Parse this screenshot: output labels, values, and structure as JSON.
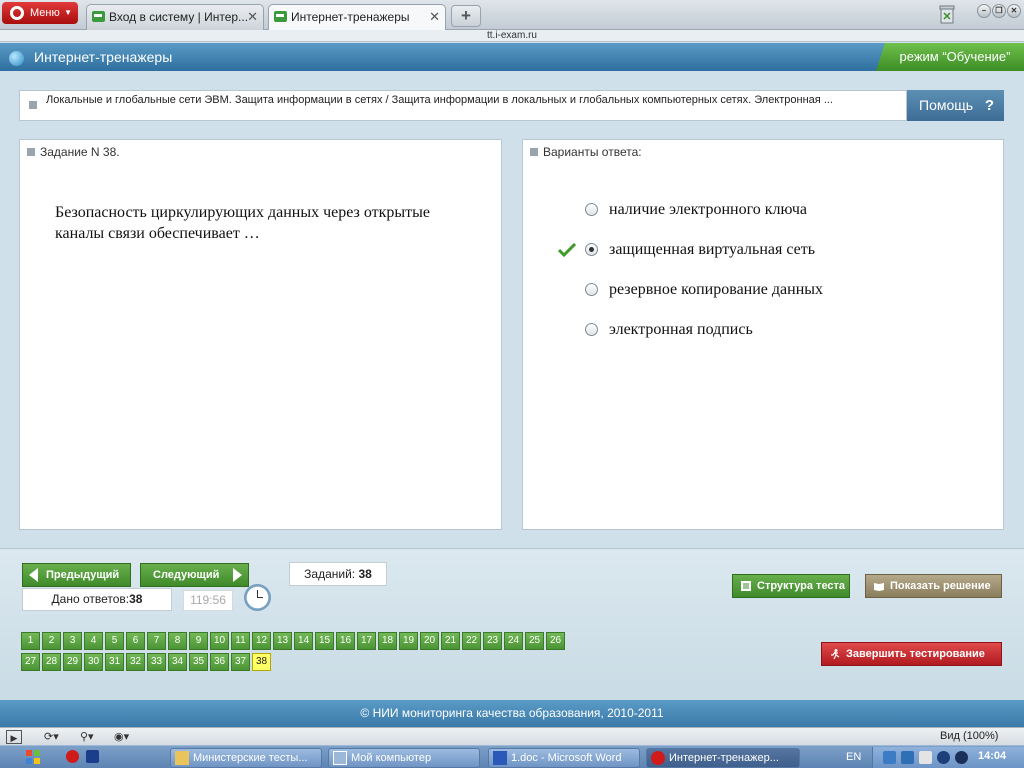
{
  "browser": {
    "menu_label": "Меню",
    "tabs": [
      {
        "label": "Вход в систему | Интер..."
      },
      {
        "label": "Интернет-тренажеры"
      }
    ],
    "address": "tt.i-exam.ru",
    "zoom_label": "Вид (100%)"
  },
  "app": {
    "title": "Интернет-тренажеры",
    "mode": "режим “Обучение”",
    "breadcrumb": "Локальные и глобальные сети ЭВМ. Защита информации в сетях / Защита информации в локальных и глобальных компьютерных сетях. Электронная ...",
    "help_label": "Помощь",
    "help_mark": "?"
  },
  "question": {
    "header": "Задание N 38.",
    "text": "Безопасность циркулирующих данных через открытые каналы связи обеспечивает …"
  },
  "answers": {
    "header": "Варианты ответа:",
    "options": [
      {
        "label": "наличие электронного ключа",
        "selected": false
      },
      {
        "label": "защищенная виртуальная сеть",
        "selected": true
      },
      {
        "label": "резервное копирование данных",
        "selected": false
      },
      {
        "label": "электронная подпись",
        "selected": false
      }
    ]
  },
  "controls": {
    "prev_label": "Предыдущий",
    "next_label": "Следующий",
    "tasks_label": "Заданий:",
    "tasks_count": "38",
    "answered_label": "Дано ответов:",
    "answered_count": "38",
    "timer": "119:56",
    "structure_label": "Структура теста",
    "solution_label": "Показать решение",
    "finish_label": "Завершить тестирование"
  },
  "task_numbers": [
    "1",
    "2",
    "3",
    "4",
    "5",
    "6",
    "7",
    "8",
    "9",
    "10",
    "11",
    "12",
    "13",
    "14",
    "15",
    "16",
    "17",
    "18",
    "19",
    "20",
    "21",
    "22",
    "23",
    "24",
    "25",
    "26",
    "27",
    "28",
    "29",
    "30",
    "31",
    "32",
    "33",
    "34",
    "35",
    "36",
    "37",
    "38"
  ],
  "current_task": "38",
  "footer": "© НИИ мониторинга качества образования, 2010-2011",
  "taskbar": {
    "items": [
      {
        "label": "Министерские тесты..."
      },
      {
        "label": "Мой компьютер"
      },
      {
        "label": "1.doc - Microsoft Word"
      },
      {
        "label": "Интернет-тренажер..."
      }
    ],
    "lang": "EN",
    "clock": "14:04"
  },
  "colors": {
    "accent_blue": "#3a79a8",
    "green_button": "#4b9434",
    "finish_red": "#c8222a",
    "current_task": "#ffff66"
  }
}
